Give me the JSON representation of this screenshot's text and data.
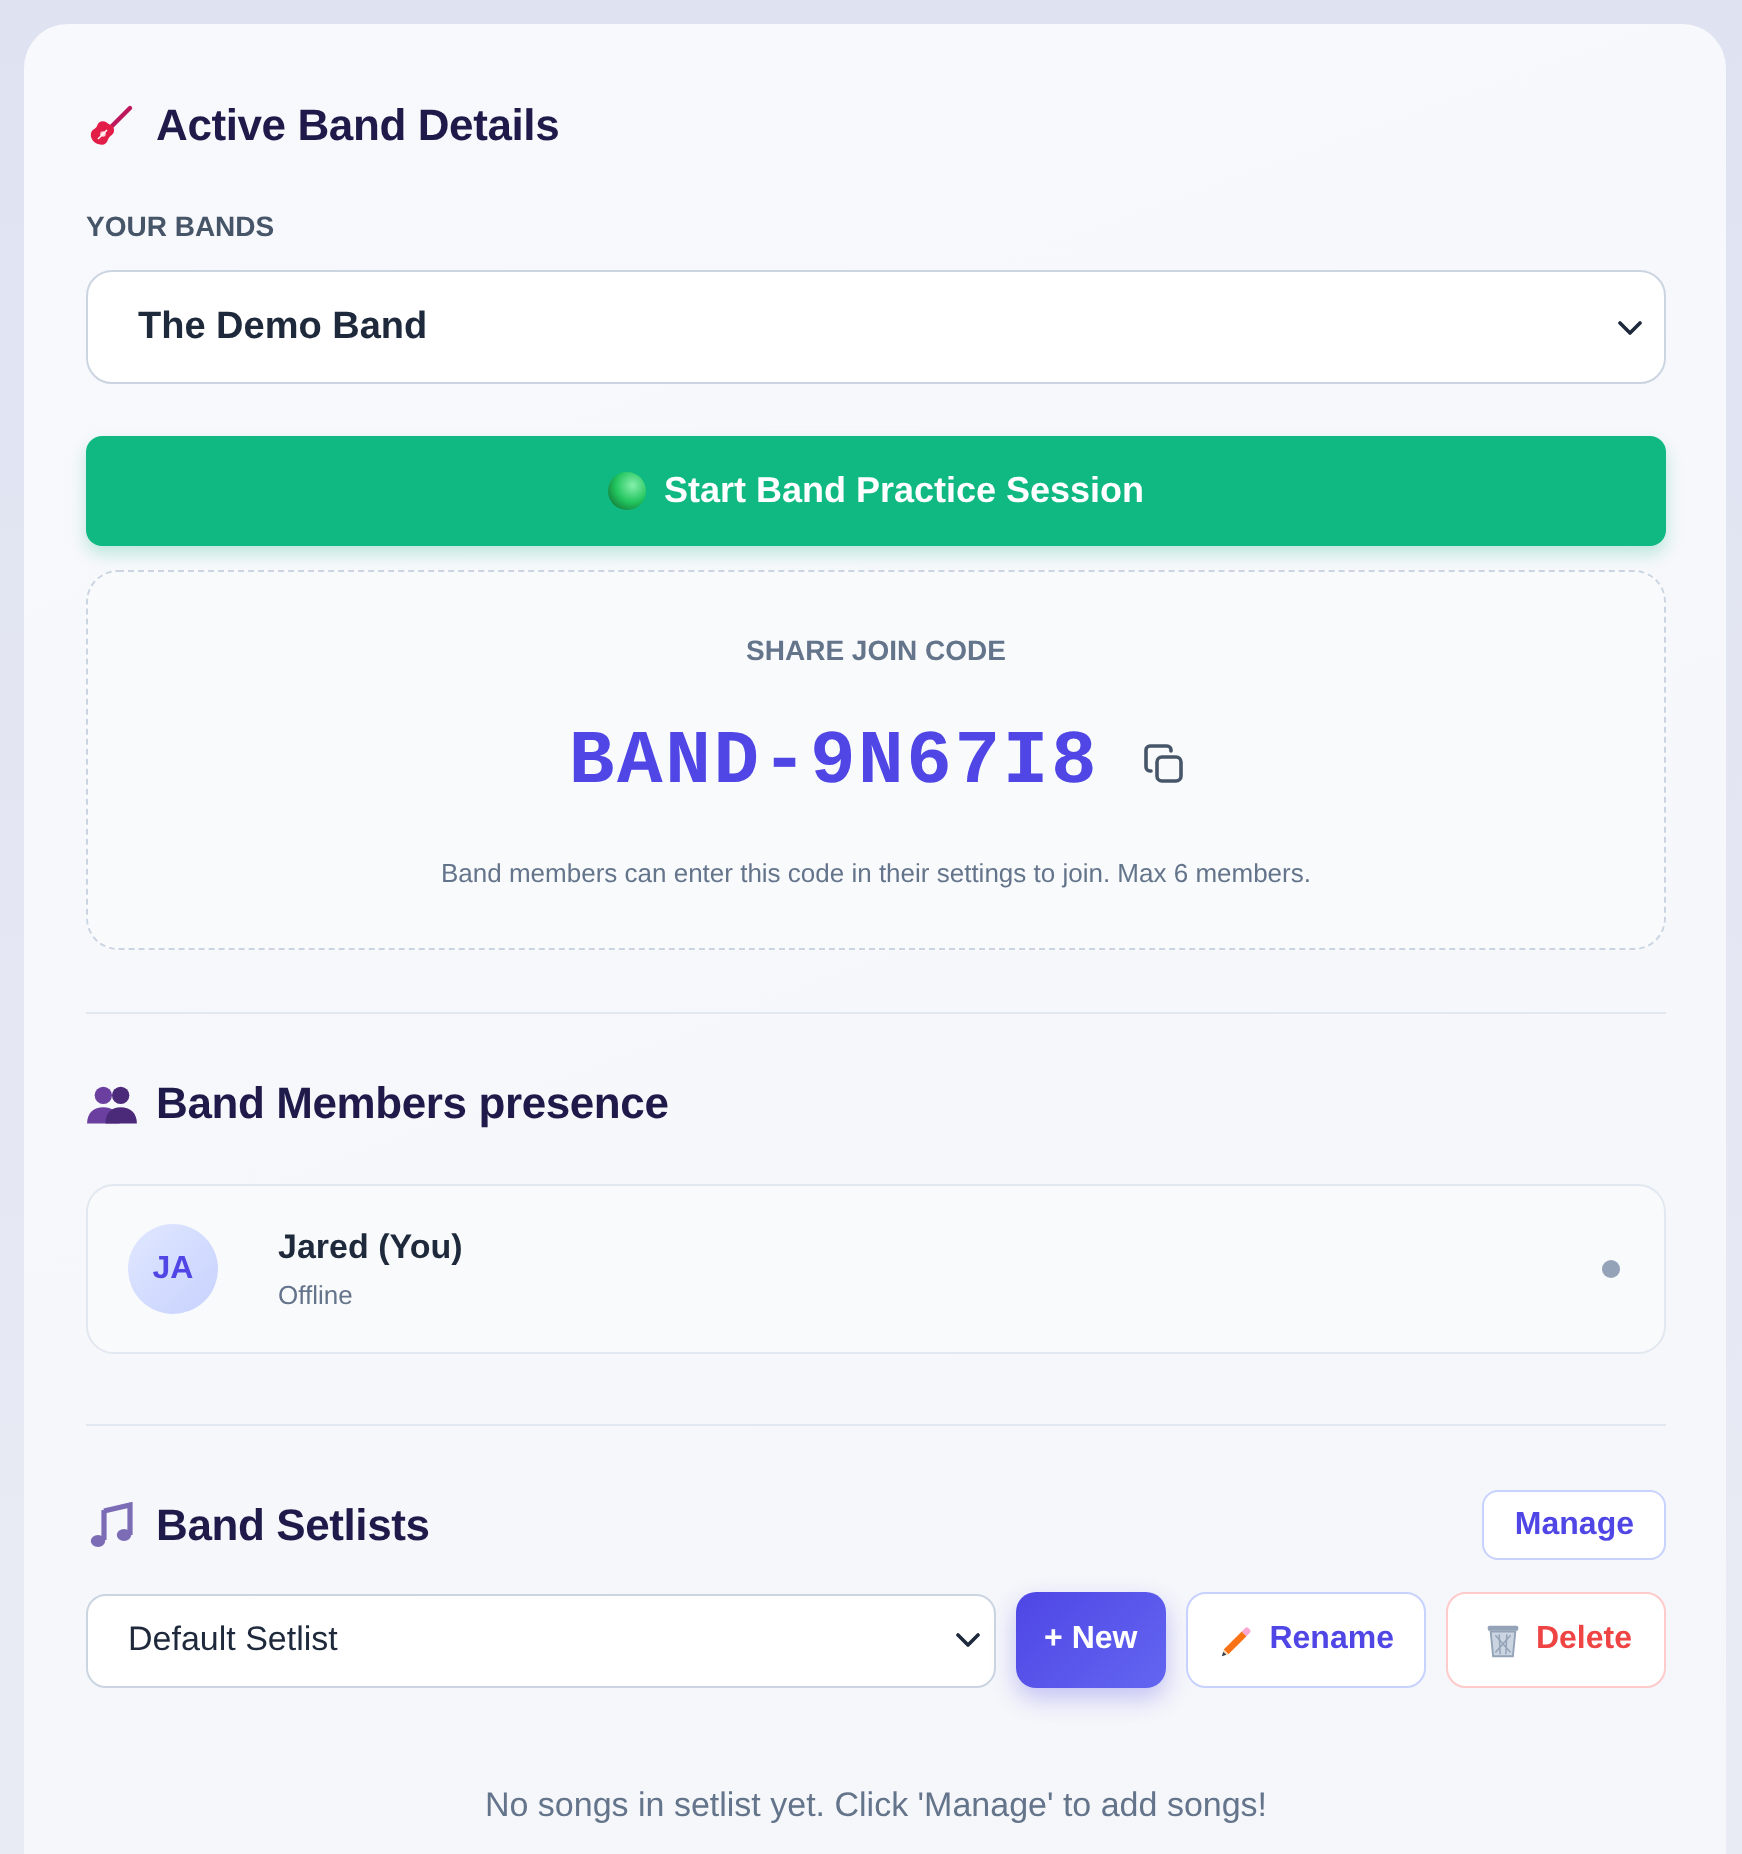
{
  "band_details": {
    "title": "Active Band Details",
    "bands_label": "YOUR BANDS",
    "band_select": {
      "value": "The Demo Band"
    },
    "practice_button": "Start Band Practice Session",
    "join_code": {
      "label": "SHARE JOIN CODE",
      "code": "BAND-9N67I8",
      "hint": "Band members can enter this code in their settings to join. Max 6 members."
    }
  },
  "members": {
    "title": "Band Members presence",
    "items": [
      {
        "initials": "JA",
        "name": "Jared (You)",
        "status": "Offline",
        "online": false
      }
    ]
  },
  "setlists": {
    "title": "Band Setlists",
    "manage_button": "Manage",
    "setlist_select": {
      "value": "Default Setlist"
    },
    "buttons": [
      {
        "kind": "new",
        "label": "+ New"
      },
      {
        "kind": "rename",
        "label": "Rename"
      },
      {
        "kind": "delete",
        "label": "Delete"
      }
    ],
    "empty_message": "No songs in setlist yet. Click 'Manage' to add songs!"
  }
}
